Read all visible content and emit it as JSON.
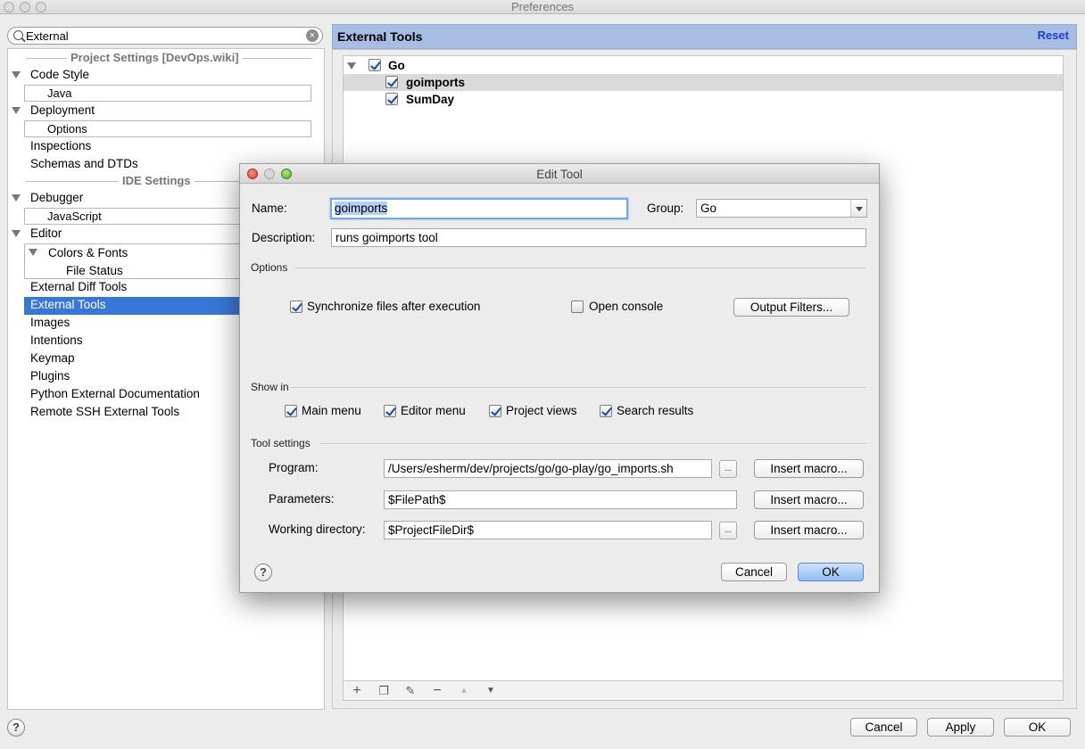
{
  "window": {
    "title": "Preferences"
  },
  "search": {
    "value": "External"
  },
  "tree": {
    "project_header": "Project Settings [DevOps.wiki]",
    "ide_header": "IDE Settings",
    "items": {
      "code_style": "Code Style",
      "java": "Java",
      "deployment": "Deployment",
      "options": "Options",
      "inspections": "Inspections",
      "schemas": "Schemas and DTDs",
      "debugger": "Debugger",
      "javascript": "JavaScript",
      "editor": "Editor",
      "colors_fonts": "Colors & Fonts",
      "file_status": "File Status",
      "external_diff": "External Diff Tools",
      "external_tools": "External Tools",
      "images": "Images",
      "intentions": "Intentions",
      "keymap": "Keymap",
      "plugins": "Plugins",
      "python_doc": "Python External Documentation",
      "remote_ssh": "Remote SSH External Tools"
    }
  },
  "panel": {
    "title": "External Tools",
    "reset": "Reset",
    "tools": {
      "group": "Go",
      "tool1": "goimports",
      "tool2": "SumDay"
    }
  },
  "dialog": {
    "title": "Edit Tool",
    "name_label": "Name:",
    "name_value": "goimports",
    "group_label": "Group:",
    "group_value": "Go",
    "description_label": "Description:",
    "description_value": "runs goimports tool",
    "options_header": "Options",
    "sync_label": "Synchronize files after execution",
    "console_label": "Open console",
    "output_filters": "Output Filters...",
    "show_in_header": "Show in",
    "main_menu": "Main menu",
    "editor_menu": "Editor menu",
    "project_views": "Project views",
    "search_results": "Search results",
    "tool_settings_header": "Tool settings",
    "program_label": "Program:",
    "program_value": "/Users/esherm/dev/projects/go/go-play/go_imports.sh",
    "parameters_label": "Parameters:",
    "parameters_value": "$FilePath$",
    "workdir_label": "Working directory:",
    "workdir_value": "$ProjectFileDir$",
    "insert_macro": "Insert macro...",
    "browse": "...",
    "cancel": "Cancel",
    "ok": "OK"
  },
  "footer": {
    "cancel": "Cancel",
    "apply": "Apply",
    "ok": "OK",
    "help": "?"
  }
}
